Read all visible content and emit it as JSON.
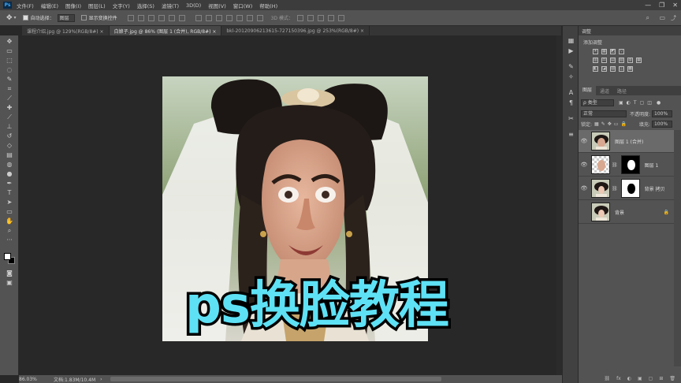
{
  "menubar": {
    "logo": "Ps",
    "items": [
      "文件(F)",
      "编辑(E)",
      "图像(I)",
      "图层(L)",
      "文字(Y)",
      "选择(S)",
      "滤镜(T)",
      "3D(D)",
      "视图(V)",
      "窗口(W)",
      "帮助(H)"
    ],
    "minimize": "—",
    "maximize": "❐",
    "close": "✕"
  },
  "options": {
    "auto_select_label": "自动选择：",
    "auto_select_value": "图层",
    "show_transform_label": "显示变换控件",
    "mode_3d": "3D 模式："
  },
  "tabs": [
    {
      "label": "课程介绍.jpg @ 129%(RGB/8#) ×"
    },
    {
      "label": "白娘子.jpg @ 86% (图层 1 (合并), RGB/8#) ×"
    },
    {
      "label": "bkl-20120906213615-727150396.jpg @ 253%(RGB/8#) ×"
    }
  ],
  "status": {
    "zoom": "86.03%",
    "doc": "文档:1.83M/10.4M",
    "arrow": "›"
  },
  "overlay": {
    "title": "ps换脸教程"
  },
  "adjustments": {
    "panel_title": "调整",
    "add_label": "添加调整",
    "icons_row1": [
      "☀",
      "▦",
      "◩",
      "▽"
    ],
    "icons_row2": [
      "▥",
      "⚖",
      "▤",
      "▧",
      "◍",
      "▦"
    ],
    "icons_row3": [
      "◧",
      "◪",
      "▨",
      "◫",
      "▩"
    ]
  },
  "layers_panel": {
    "tabs": [
      "图层",
      "通道",
      "路径"
    ],
    "filter_kind": "ρ 类型",
    "blend_mode": "正常",
    "opacity_label": "不透明度:",
    "opacity_value": "100%",
    "lock_label": "锁定:",
    "fill_label": "填充:",
    "fill_value": "100%",
    "layers": [
      {
        "name": "图层 1 (合并)",
        "visible": true,
        "selected": true,
        "has_mask": false
      },
      {
        "name": "图层 1",
        "visible": true,
        "selected": false,
        "has_mask": true
      },
      {
        "name": "背景 拷贝",
        "visible": true,
        "selected": false,
        "has_mask": true
      },
      {
        "name": "背景",
        "visible": false,
        "selected": false,
        "has_mask": false,
        "locked": true
      }
    ],
    "bottom_icons": [
      "fx",
      "◐",
      "▣",
      "▢",
      "🗑"
    ]
  },
  "colors": {
    "title_fill": "#5ee1f5",
    "title_stroke": "#000000",
    "panel_bg": "#535353",
    "canvas_bg": "#282828"
  }
}
